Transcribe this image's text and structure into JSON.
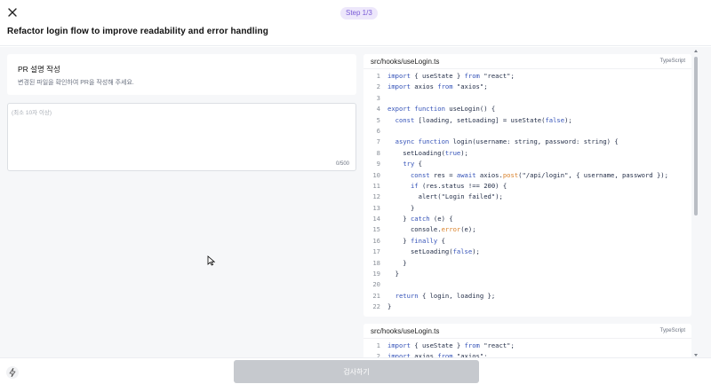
{
  "header": {
    "close_icon": "close-icon",
    "step_label": "Step 1/3",
    "title": "Refactor login flow to improve readability and error handling"
  },
  "pr_card": {
    "title": "PR 설명 작성",
    "description": "변경된 파일을 확인하여 PR을 작성해 주세요."
  },
  "description_input": {
    "placeholder": "(최소 10자 이상)",
    "value": "",
    "char_count": "0/500"
  },
  "files": [
    {
      "filename": "src/hooks/useLogin.ts",
      "language": "TypeScript",
      "lines": [
        {
          "no": "1",
          "code": "import { useState } from \"react\";"
        },
        {
          "no": "2",
          "code": "import axios from \"axios\";"
        },
        {
          "no": "3",
          "code": ""
        },
        {
          "no": "4",
          "code": "export function useLogin() {"
        },
        {
          "no": "5",
          "code": "  const [loading, setLoading] = useState(false);"
        },
        {
          "no": "6",
          "code": ""
        },
        {
          "no": "7",
          "code": "  async function login(username: string, password: string) {"
        },
        {
          "no": "8",
          "code": "    setLoading(true);"
        },
        {
          "no": "9",
          "code": "    try {"
        },
        {
          "no": "10",
          "code": "      const res = await axios.post(\"/api/login\", { username, password });"
        },
        {
          "no": "11",
          "code": "      if (res.status !== 200) {"
        },
        {
          "no": "12",
          "code": "        alert(\"Login failed\");"
        },
        {
          "no": "13",
          "code": "      }"
        },
        {
          "no": "14",
          "code": "    } catch (e) {"
        },
        {
          "no": "15",
          "code": "      console.error(e);"
        },
        {
          "no": "16",
          "code": "    } finally {"
        },
        {
          "no": "17",
          "code": "      setLoading(false);"
        },
        {
          "no": "18",
          "code": "    }"
        },
        {
          "no": "19",
          "code": "  }"
        },
        {
          "no": "20",
          "code": ""
        },
        {
          "no": "21",
          "code": "  return { login, loading };"
        },
        {
          "no": "22",
          "code": "}"
        }
      ]
    },
    {
      "filename": "src/hooks/useLogin.ts",
      "language": "TypeScript",
      "lines": [
        {
          "no": "1",
          "code": "import { useState } from \"react\";"
        },
        {
          "no": "2",
          "code": "import axios from \"axios\";"
        }
      ]
    }
  ],
  "footer": {
    "bolt_icon": "bolt-icon",
    "submit_label": "검사하기"
  },
  "colors": {
    "keyword": "#3553b8",
    "method_highlight": "#d9822b",
    "step_badge_bg": "#ede7fb",
    "step_badge_text": "#7a5bd6",
    "submit_disabled": "#c6c9ce"
  }
}
